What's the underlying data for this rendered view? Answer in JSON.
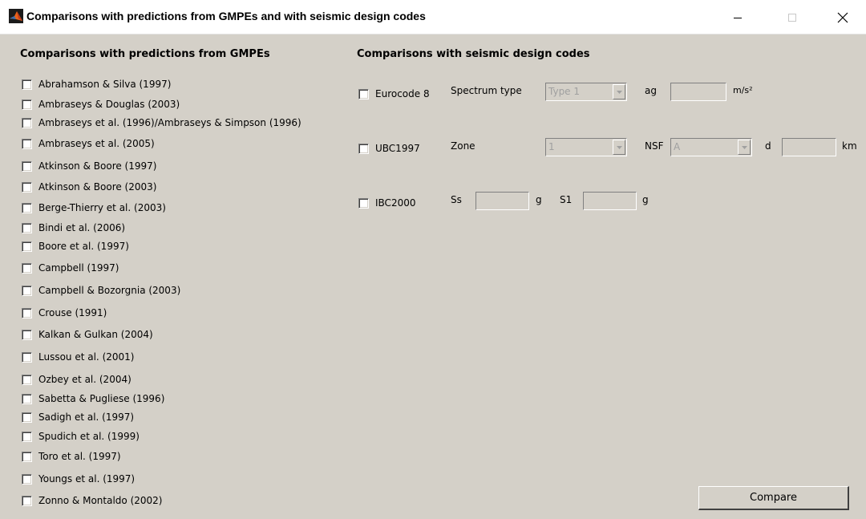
{
  "window": {
    "title": "Comparisons with predictions from GMPEs and with seismic design codes",
    "icon": "matlab-icon"
  },
  "gmpe": {
    "header": "Comparisons with predictions from GMPEs",
    "items": [
      {
        "label": "Abrahamson & Silva (1997)",
        "checked": false
      },
      {
        "label": "Ambraseys & Douglas (2003)",
        "checked": false
      },
      {
        "label": "Ambraseys et al. (1996)/Ambraseys & Simpson (1996)",
        "checked": false
      },
      {
        "label": "Ambraseys et al. (2005)",
        "checked": false
      },
      {
        "label": "Atkinson & Boore (1997)",
        "checked": false
      },
      {
        "label": "Atkinson & Boore (2003)",
        "checked": false
      },
      {
        "label": "Berge-Thierry et al. (2003)",
        "checked": false
      },
      {
        "label": "Bindi et al. (2006)",
        "checked": false
      },
      {
        "label": "Boore et al. (1997)",
        "checked": false
      },
      {
        "label": "Campbell (1997)",
        "checked": false
      },
      {
        "label": "Campbell & Bozorgnia (2003)",
        "checked": false
      },
      {
        "label": "Crouse (1991)",
        "checked": false
      },
      {
        "label": "Kalkan & Gulkan (2004)",
        "checked": false
      },
      {
        "label": "Lussou et al. (2001)",
        "checked": false
      },
      {
        "label": "Ozbey et al. (2004)",
        "checked": false
      },
      {
        "label": "Sabetta & Pugliese (1996)",
        "checked": false
      },
      {
        "label": "Sadigh et al. (1997)",
        "checked": false
      },
      {
        "label": "Spudich et al. (1999)",
        "checked": false
      },
      {
        "label": "Toro et al. (1997)",
        "checked": false
      },
      {
        "label": "Youngs et al. (1997)",
        "checked": false
      },
      {
        "label": "Zonno & Montaldo (2002)",
        "checked": false
      }
    ]
  },
  "codes": {
    "header": "Comparisons with seismic design codes",
    "eurocode8": {
      "checkbox_label": "Eurocode 8",
      "spectrum_type_label": "Spectrum type",
      "spectrum_type_value": "Type 1",
      "ag_label": "ag",
      "ag_value": "",
      "ag_unit": "m/s²"
    },
    "ubc1997": {
      "checkbox_label": "UBC1997",
      "zone_label": "Zone",
      "zone_value": "1",
      "nsf_label": "NSF",
      "nsf_value": "A",
      "d_label": "d",
      "d_value": "",
      "d_unit": "km"
    },
    "ibc2000": {
      "checkbox_label": "IBC2000",
      "ss_label": "Ss",
      "ss_value": "",
      "ss_unit": "g",
      "s1_label": "S1",
      "s1_value": "",
      "s1_unit": "g"
    }
  },
  "compare_button": "Compare"
}
